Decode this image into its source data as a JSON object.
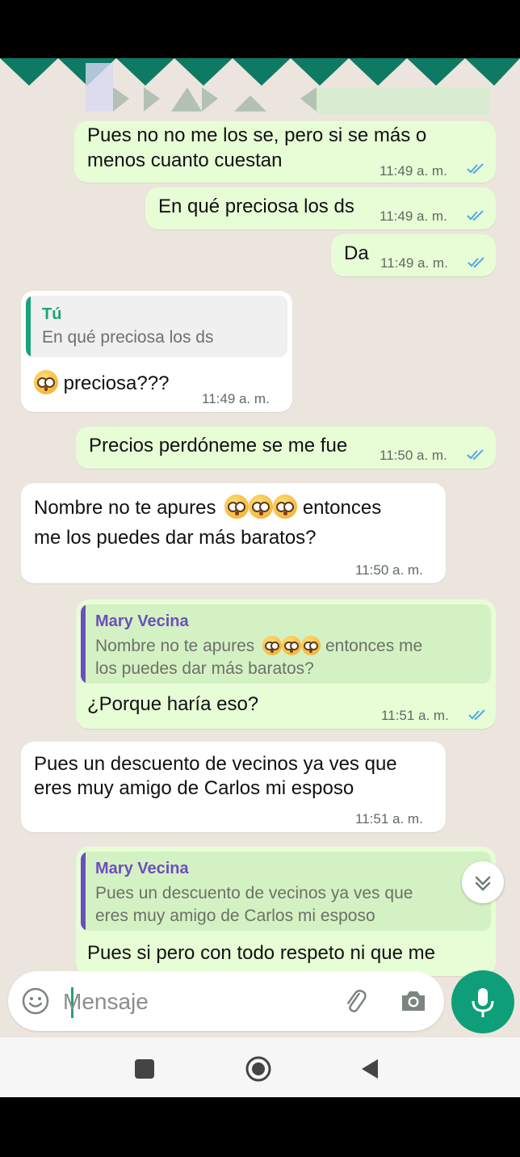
{
  "messages": [
    {
      "direction": "out",
      "lines": [
        "Pues no no me los se, pero si se más o",
        "menos cuanto cuestan"
      ],
      "time": "11:49 a. m.",
      "status": "read"
    },
    {
      "direction": "out",
      "text": "En qué preciosa los ds",
      "time": "11:49 a. m.",
      "status": "read"
    },
    {
      "direction": "out",
      "text": "Da",
      "time": "11:49 a. m.",
      "status": "read"
    },
    {
      "direction": "in",
      "reply_to": {
        "author": "Tú",
        "text": "En qué preciosa los ds"
      },
      "text": "preciosa???",
      "emoji": "flushed-face",
      "time": "11:49 a. m."
    },
    {
      "direction": "out",
      "text": "Precios perdóneme se me fue",
      "time": "11:50 a. m.",
      "status": "read"
    },
    {
      "direction": "in",
      "lines": [
        "Nombre no te apures",
        "entonces",
        "me los puedes dar más baratos?"
      ],
      "time": "11:50 a. m."
    },
    {
      "direction": "out",
      "reply_to": {
        "author": "Mary Vecina",
        "lines": [
          "Nombre no te apures",
          "entonces me",
          "los puedes dar más baratos?"
        ]
      },
      "text": "¿Porque haría eso?",
      "time": "11:51 a. m.",
      "status": "read"
    },
    {
      "direction": "in",
      "lines": [
        "Pues un descuento de vecinos ya ves que",
        "eres muy amigo de Carlos mi esposo"
      ],
      "time": "11:51 a. m."
    },
    {
      "direction": "out",
      "reply_to": {
        "author": "Mary Vecina",
        "lines": [
          "Pues un descuento de vecinos ya ves que",
          "eres muy amigo de Carlos mi esposo"
        ]
      },
      "text": "Pues si pero con todo respeto ni que me"
    }
  ],
  "composer": {
    "placeholder": "Mensaje"
  },
  "colors": {
    "accent_green": "#0e9e7a",
    "read_ticks": "#4fa8e6",
    "you_author": "#1aa37a",
    "mary_author": "#6b4fbb",
    "mary_bar": "#6b4fbb",
    "you_bar": "#1aa37a"
  }
}
